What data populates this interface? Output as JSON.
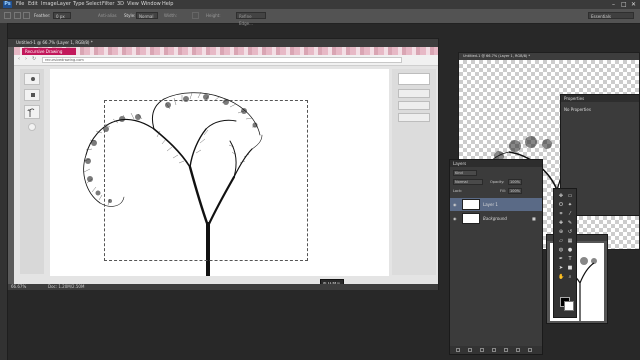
{
  "app": {
    "logo": "Ps"
  },
  "menu": [
    "File",
    "Edit",
    "Image",
    "Layer",
    "Type",
    "Select",
    "Filter",
    "3D",
    "View",
    "Window",
    "Help"
  ],
  "window_controls": [
    "–",
    "□",
    "✕"
  ],
  "options": {
    "feather_label": "Feather:",
    "feather_value": "0 px",
    "antialias": "Anti-alias",
    "style_label": "Style:",
    "style_value": "Normal",
    "width_label": "Width:",
    "height_label": "Height:",
    "refine": "Refine Edge...",
    "workspace": "Essentials"
  },
  "doc_main": {
    "title": "Untitled-1 @ 66.7% (Layer 1, RGB/8) *",
    "tab_label": "Recursive Drawing",
    "address": "recursivedrawing.com",
    "zoom": "66.67%",
    "doc_size": "Doc: 1.20M/2.50M",
    "tooltip_w": "W: 11.58 in",
    "tooltip_h": "H: 10.00 in"
  },
  "doc_second": {
    "title": "Untitled-1 @ 66.7% (Layer 1, RGB/8) *"
  },
  "properties": {
    "title": "Properties",
    "sub": "No Properties"
  },
  "layers": {
    "title": "Layers",
    "kind": "Kind",
    "blend": "Normal",
    "opacity_label": "Opacity:",
    "opacity": "100%",
    "lock_label": "Lock:",
    "fill_label": "Fill:",
    "fill": "100%",
    "items": [
      {
        "name": "Layer 1"
      },
      {
        "name": "Background"
      }
    ]
  },
  "icons": {
    "eye": "eye-icon",
    "lock": "lock-icon"
  }
}
